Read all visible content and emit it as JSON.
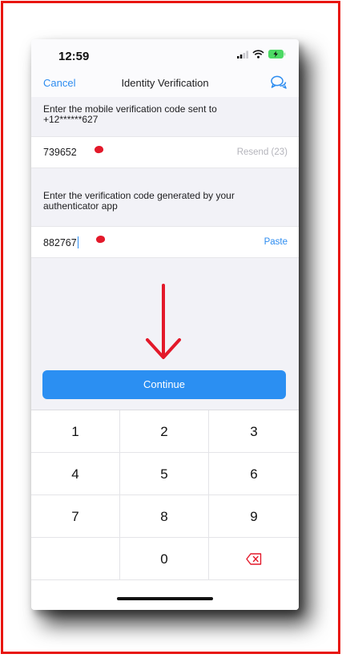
{
  "status_bar": {
    "time": "12:59"
  },
  "nav": {
    "cancel_label": "Cancel",
    "title": "Identity Verification",
    "chat_icon": "chat-bubbles-icon"
  },
  "sms_section": {
    "instruction_line1": "Enter the mobile verification code sent to",
    "instruction_line2": "+12******627",
    "code_value": "739652",
    "resend_label": "Resend (23)"
  },
  "auth_section": {
    "instruction_line1": "Enter the verification code generated by your",
    "instruction_line2": "authenticator app",
    "code_value": "882767",
    "paste_label": "Paste"
  },
  "continue_label": "Continue",
  "keypad": {
    "keys": [
      "1",
      "2",
      "3",
      "4",
      "5",
      "6",
      "7",
      "8",
      "9",
      "",
      "0",
      "backspace-icon"
    ]
  },
  "colors": {
    "accent": "#2c8cf0",
    "button": "#2b8ff2",
    "annotation_red": "#e3192a",
    "frame_red": "#e8150f",
    "battery_green": "#4cd964"
  }
}
